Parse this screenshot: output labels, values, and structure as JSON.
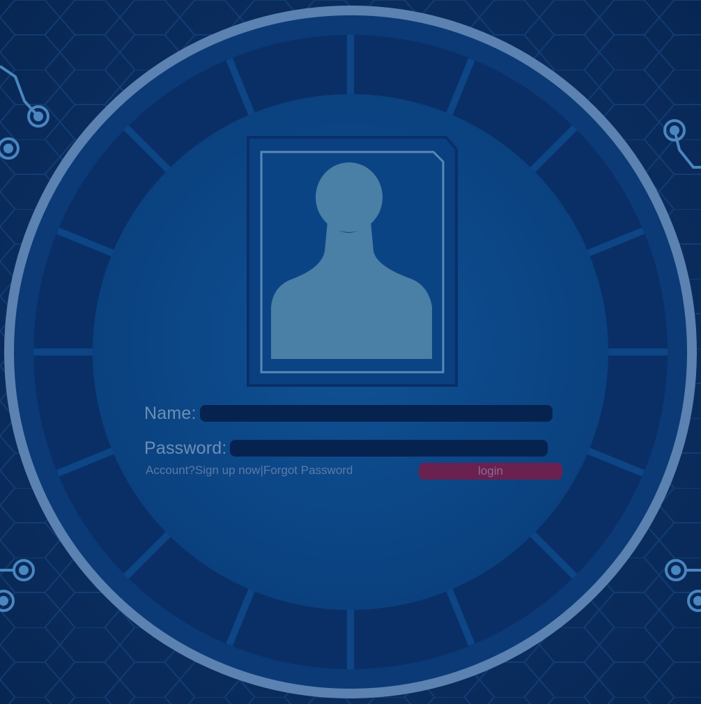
{
  "form": {
    "name_label": "Name:",
    "name_value": "",
    "password_label": "Password:",
    "password_value": "",
    "account_prompt": "Account?",
    "signup_link": "Sign up now",
    "separator": "|",
    "forgot_link": "Forgot Password",
    "login_button": "login"
  },
  "colors": {
    "background": "#0a2f63",
    "ring": "#5b82b0",
    "inner_circle": "#0d4a8c",
    "avatar": "#4a7fa6",
    "field": "#062350",
    "label": "#6e8fb3",
    "login_button": "#6a2150"
  },
  "icons": {
    "avatar": "user-silhouette-icon",
    "circuit_nodes": "circuit-node-icon"
  }
}
